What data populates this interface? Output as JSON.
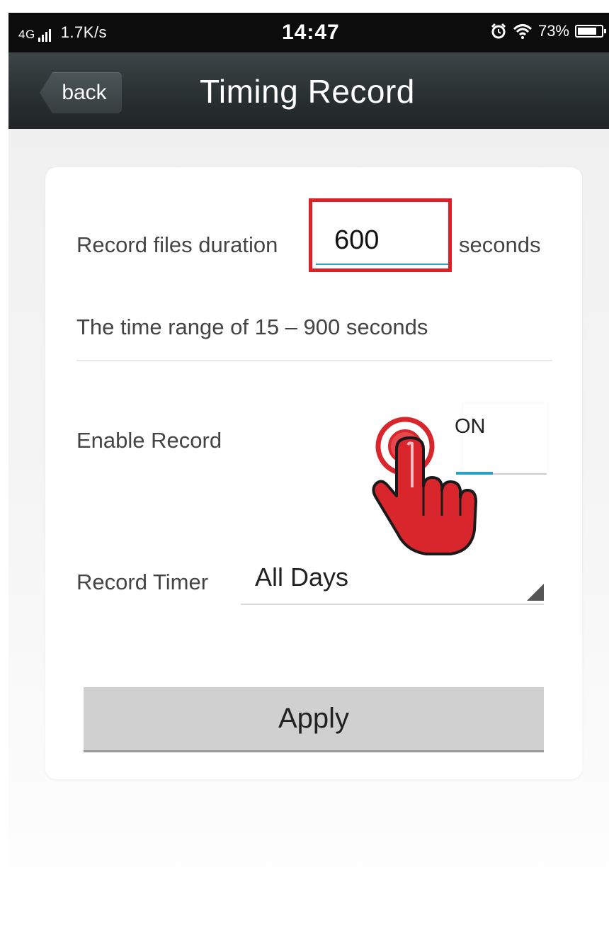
{
  "status_bar": {
    "network": "4G",
    "speed": "1.7K/s",
    "time": "14:47",
    "battery": "73%",
    "icons": [
      "signal-icon",
      "alarm-icon",
      "wifi-icon",
      "battery-icon"
    ]
  },
  "nav": {
    "back_label": "back",
    "title": "Timing Record"
  },
  "form": {
    "duration_label": "Record files duration",
    "duration_value": "600",
    "duration_unit": "seconds",
    "range_hint": "The time range of 15 – 900 seconds",
    "enable_label": "Enable Record",
    "enable_state": "ON",
    "timer_label": "Record Timer",
    "timer_value": "All Days",
    "apply_label": "Apply"
  },
  "colors": {
    "accent": "#2b9fc5",
    "highlight": "#dd1f26",
    "nav_bar": "#2a3133"
  }
}
